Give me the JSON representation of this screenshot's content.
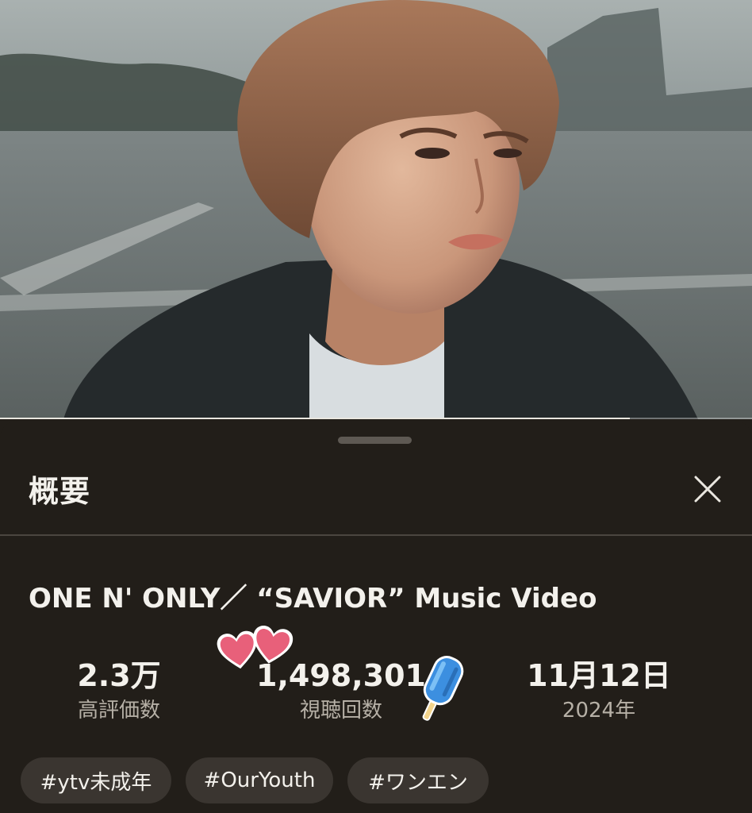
{
  "video": {
    "progress_fraction": 0.838
  },
  "sheet": {
    "title": "概要",
    "close_icon": "close-icon"
  },
  "details": {
    "title": "ONE N' ONLY／ “SAVIOR” Music Video",
    "stats": {
      "likes": {
        "value": "2.3万",
        "label": "高評価数"
      },
      "views": {
        "value": "1,498,301",
        "label": "視聴回数"
      },
      "date": {
        "value": "11月12日",
        "label": "2024年"
      }
    },
    "stickers": [
      "hearts-sticker",
      "popsicle-sticker"
    ]
  },
  "tags": [
    "#ytv未成年",
    "#OurYouth",
    "#ワンエン"
  ],
  "colors": {
    "sheet_background": "#221e19",
    "chip_background": "#3a3530",
    "text_primary": "#f3f1ec",
    "text_secondary": "#b6b0a6",
    "heart_pink": "#e8607a",
    "popsicle_blue": "#3c8fe0"
  }
}
